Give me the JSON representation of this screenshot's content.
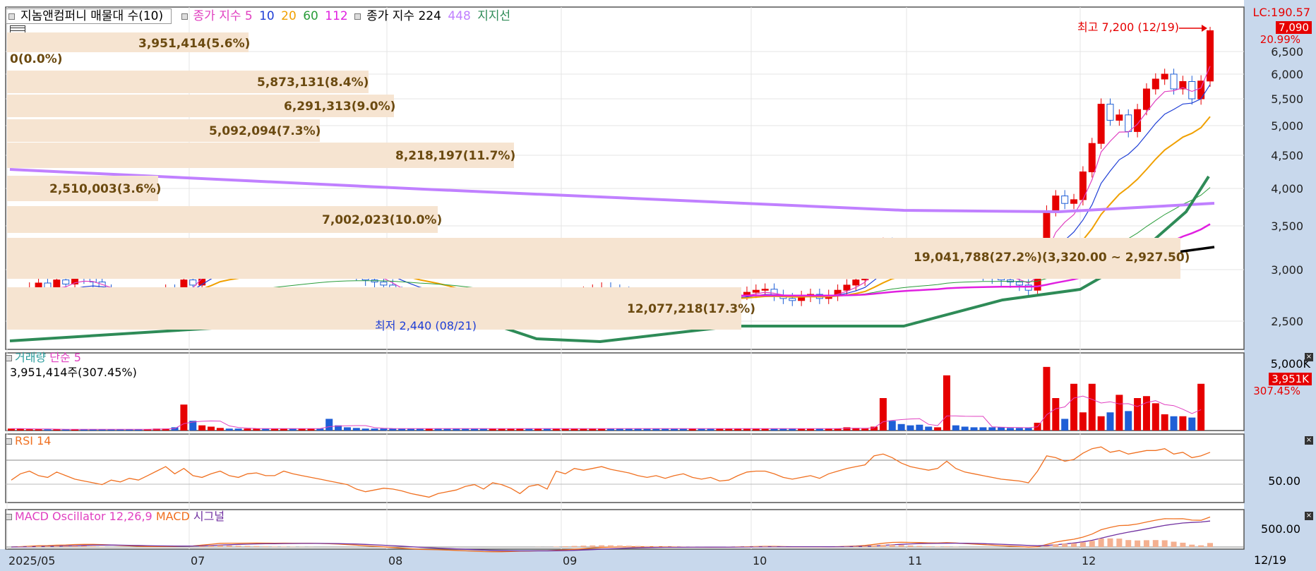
{
  "legend": {
    "title": "지놈앤컴퍼니 매물대 수(10)",
    "ma_label": "종가 지수 5",
    "ma_periods": [
      "10",
      "20",
      "60",
      "112"
    ],
    "ma224_label": "종가 지수 224",
    "ma448": "448",
    "support_label": "지지선"
  },
  "volume_profile": [
    {
      "label": "3,951,414(5.6%)"
    },
    {
      "label": "0(0.0%)"
    },
    {
      "label": "5,873,131(8.4%)"
    },
    {
      "label": "6,291,313(9.0%)"
    },
    {
      "label": "5,092,094(7.3%)"
    },
    {
      "label": "8,218,197(11.7%)"
    },
    {
      "label": "2,510,003(3.6%)"
    },
    {
      "label": "7,002,023(10.0%)"
    },
    {
      "label": "19,041,788(27.2%)(3,320.00 ~ 2,927.50)"
    },
    {
      "label": "12,077,218(17.3%)"
    }
  ],
  "price_axis": {
    "lc": "LC:190.57",
    "current": "7,090",
    "change": "20.99%",
    "ticks": [
      "6,500",
      "6,000",
      "5,500",
      "5,000",
      "4,500",
      "4,000",
      "3,500",
      "3,000",
      "2,500"
    ]
  },
  "annotations": {
    "high": "최고 7,200 (12/19)",
    "low": "최저 2,440 (08/21)"
  },
  "volume_panel": {
    "title": "거래량",
    "ma_label": "단순 5",
    "info": "3,951,414주(307.45%)",
    "tick": "5,000K",
    "current": "3,951K",
    "pct": "307.45%"
  },
  "rsi_panel": {
    "title": "RSI 14",
    "tick": "50.00"
  },
  "macd_panel": {
    "title": "MACD Oscillator 12,26,9",
    "macd": "MACD",
    "signal": "시그널",
    "tick": "500.00"
  },
  "x_axis": {
    "labels": [
      "2025/05",
      "07",
      "08",
      "09",
      "10",
      "11",
      "12"
    ],
    "last": "12/19"
  },
  "colors": {
    "up": "#e60000",
    "down": "#1f5fd6",
    "ma5": "#e040c0",
    "ma10": "#1f3fd6",
    "ma20": "#f0a000",
    "ma60": "#2a9d3a",
    "ma112": "#e020e0",
    "ma224": "#000000",
    "ma448": "#c080ff",
    "support": "#2e8b57"
  },
  "chart_data": {
    "type": "candlestick",
    "start_price": 2650,
    "ylim": [
      2300,
      7300
    ],
    "closes": [
      2650,
      2760,
      2820,
      2870,
      2780,
      2900,
      2860,
      2950,
      2920,
      2880,
      2800,
      2760,
      2720,
      2700,
      2680,
      2720,
      2750,
      2800,
      2780,
      2900,
      2850,
      3100,
      3150,
      3250,
      3080,
      3050,
      3100,
      3120,
      3080,
      3100,
      3150,
      3120,
      3140,
      3150,
      3120,
      3100,
      3050,
      3000,
      2950,
      2900,
      2880,
      2850,
      2780,
      2720,
      2700,
      2680,
      2720,
      2700,
      2650,
      2600,
      2550,
      2500,
      2480,
      2500,
      2520,
      2580,
      2620,
      2560,
      2580,
      2500,
      2650,
      2680,
      2720,
      2780,
      2800,
      2820,
      2800,
      2780,
      2760,
      2750,
      2740,
      2730,
      2720,
      2700,
      2680,
      2720,
      2700,
      2690,
      2720,
      2740,
      2760,
      2780,
      2800,
      2810,
      2750,
      2720,
      2700,
      2740,
      2760,
      2720,
      2750,
      2800,
      2850,
      2900,
      2980,
      3200,
      3300,
      3280,
      3150,
      3100,
      3080,
      3050,
      3100,
      3250,
      3080,
      3000,
      2980,
      2950,
      2920,
      2900,
      2880,
      2850,
      2800,
      3050,
      3700,
      3900,
      3800,
      3850,
      4250,
      4700,
      5400,
      5100,
      5200,
      4900,
      5300,
      5700,
      5900,
      6000,
      5700,
      5850,
      5500,
      5860,
      7090
    ],
    "volume_pct": [
      3,
      3,
      2,
      2,
      2,
      2,
      2,
      2,
      2,
      2,
      2,
      2,
      2,
      2,
      2,
      2,
      3,
      3,
      5,
      40,
      15,
      8,
      6,
      4,
      3,
      3,
      3,
      3,
      3,
      3,
      3,
      3,
      3,
      3,
      3,
      18,
      8,
      5,
      4,
      3,
      3,
      3,
      3,
      3,
      3,
      3,
      3,
      3,
      3,
      3,
      3,
      3,
      3,
      3,
      3,
      3,
      3,
      3,
      3,
      3,
      3,
      3,
      3,
      3,
      3,
      3,
      3,
      3,
      3,
      3,
      3,
      3,
      3,
      3,
      3,
      3,
      3,
      3,
      3,
      3,
      3,
      3,
      3,
      3,
      3,
      3,
      3,
      3,
      3,
      3,
      3,
      3,
      5,
      4,
      3,
      6,
      50,
      15,
      10,
      8,
      9,
      6,
      5,
      85,
      8,
      6,
      5,
      5,
      5,
      5,
      4,
      4,
      4,
      12,
      98,
      50,
      18,
      72,
      28,
      72,
      22,
      28,
      55,
      30,
      50,
      53,
      42,
      25,
      22,
      22,
      20,
      72
    ],
    "rsi": [
      45,
      52,
      55,
      50,
      48,
      54,
      50,
      46,
      44,
      42,
      40,
      45,
      43,
      47,
      45,
      50,
      55,
      60,
      52,
      58,
      50,
      48,
      52,
      55,
      50,
      48,
      52,
      53,
      50,
      50,
      55,
      52,
      50,
      48,
      46,
      44,
      42,
      40,
      35,
      32,
      34,
      36,
      35,
      33,
      30,
      28,
      26,
      30,
      32,
      34,
      38,
      40,
      35,
      42,
      40,
      36,
      30,
      38,
      40,
      35,
      55,
      52,
      58,
      56,
      58,
      60,
      57,
      55,
      53,
      50,
      48,
      50,
      47,
      50,
      52,
      48,
      46,
      48,
      44,
      45,
      50,
      54,
      55,
      55,
      52,
      48,
      46,
      48,
      50,
      47,
      52,
      55,
      58,
      60,
      62,
      72,
      74,
      70,
      64,
      60,
      58,
      56,
      58,
      66,
      58,
      54,
      52,
      50,
      48,
      46,
      45,
      44,
      42,
      55,
      72,
      70,
      66,
      68,
      75,
      80,
      82,
      76,
      78,
      74,
      76,
      78,
      78,
      80,
      74,
      76,
      70,
      72,
      76
    ],
    "macd": [
      0,
      0,
      0,
      0,
      0,
      0,
      0,
      0,
      0,
      0,
      0,
      0,
      0,
      0,
      0,
      0,
      0,
      0,
      0,
      0,
      0,
      0,
      0,
      0,
      0,
      0,
      0,
      0,
      0,
      0,
      0,
      0,
      0,
      0,
      0,
      0,
      0,
      0,
      0,
      0,
      0,
      0,
      0,
      0,
      0,
      0,
      0,
      0,
      0,
      0,
      0,
      0,
      0,
      0,
      0,
      0,
      0,
      0,
      0,
      0,
      0,
      0,
      0,
      0,
      0,
      0,
      0,
      0,
      0,
      0,
      0,
      0,
      0,
      0,
      0,
      0,
      0,
      0,
      0,
      0,
      0,
      0,
      0,
      0,
      0,
      0,
      0,
      0,
      0,
      0,
      0,
      0,
      0,
      0,
      0,
      0,
      0,
      0,
      0,
      0,
      0,
      0,
      0,
      0,
      0,
      0,
      0,
      0,
      0,
      0,
      0,
      0,
      0,
      0,
      0,
      0,
      0,
      0,
      0,
      0,
      0,
      0,
      0,
      0,
      0,
      0,
      0,
      0,
      0,
      0,
      0,
      0,
      0
    ]
  }
}
